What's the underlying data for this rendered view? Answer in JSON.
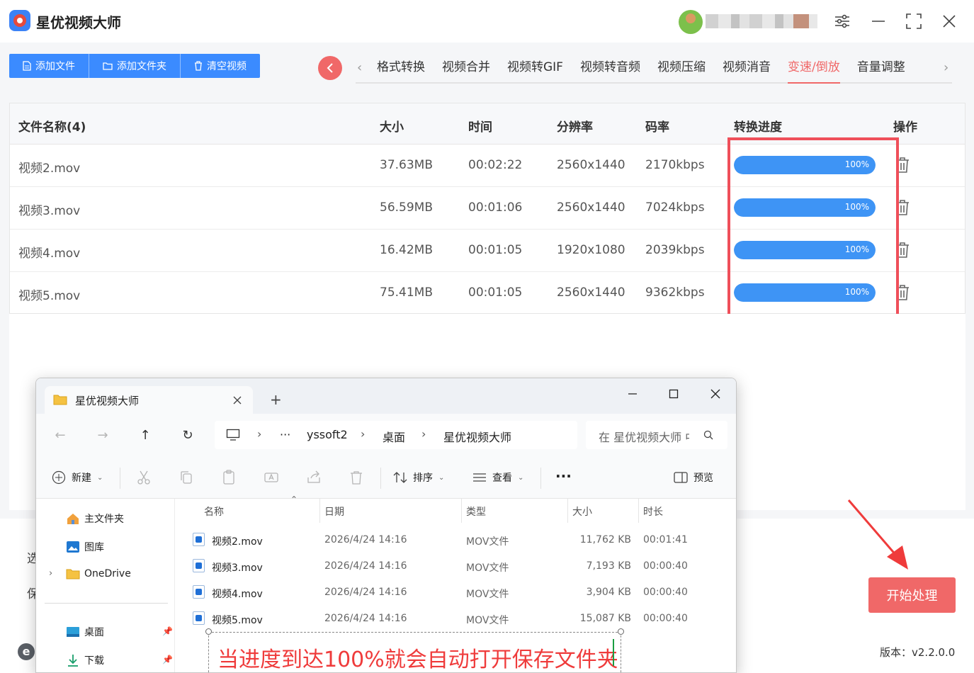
{
  "app": {
    "title": "星优视频大师",
    "version": "版本：v2.2.0.0",
    "accent": "#f06868",
    "primary": "#3b8bff"
  },
  "toolbar": {
    "add_file": "添加文件",
    "add_folder": "添加文件夹",
    "clear": "清空视频"
  },
  "tabs": [
    "格式转换",
    "视频合并",
    "视频转GIF",
    "视频转音频",
    "视频压缩",
    "视频消音",
    "变速/倒放",
    "音量调整"
  ],
  "active_tab": "变速/倒放",
  "table": {
    "headers": {
      "name": "文件名称(4)",
      "size": "大小",
      "time": "时间",
      "resolution": "分辨率",
      "bitrate": "码率",
      "progress": "转换进度",
      "action": "操作"
    },
    "rows": [
      {
        "name": "视频2.mov",
        "size": "37.63MB",
        "time": "00:02:22",
        "resolution": "2560x1440",
        "bitrate": "2170kbps",
        "progress": 100,
        "progress_label": "100%"
      },
      {
        "name": "视频3.mov",
        "size": "56.59MB",
        "time": "00:01:06",
        "resolution": "2560x1440",
        "bitrate": "7024kbps",
        "progress": 100,
        "progress_label": "100%"
      },
      {
        "name": "视频4.mov",
        "size": "16.42MB",
        "time": "00:01:05",
        "resolution": "1920x1080",
        "bitrate": "2039kbps",
        "progress": 100,
        "progress_label": "100%"
      },
      {
        "name": "视频5.mov",
        "size": "75.41MB",
        "time": "00:01:05",
        "resolution": "2560x1440",
        "bitrate": "9362kbps",
        "progress": 100,
        "progress_label": "100%"
      }
    ]
  },
  "bottom": {
    "label1": "选",
    "label2": "保",
    "start_button": "开始处理"
  },
  "explorer": {
    "tab_title": "星优视频大师",
    "breadcrumb": [
      "yssoft2",
      "桌面",
      "星优视频大师"
    ],
    "search_placeholder": "在 星优视频大师 中搜索",
    "commands": {
      "new": "新建",
      "sort": "排序",
      "view": "查看",
      "more": "···",
      "preview": "预览"
    },
    "sidebar": [
      {
        "label": "主文件夹",
        "icon": "home-icon"
      },
      {
        "label": "图库",
        "icon": "gallery-icon"
      },
      {
        "label": "OneDrive",
        "icon": "folder-icon"
      },
      {
        "label": "桌面",
        "icon": "desktop-icon"
      },
      {
        "label": "下载",
        "icon": "download-icon"
      }
    ],
    "columns": {
      "name": "名称",
      "date": "日期",
      "type": "类型",
      "size": "大小",
      "duration": "时长"
    },
    "files": [
      {
        "name": "视频2.mov",
        "date": "2026/4/24 14:16",
        "type": "MOV文件",
        "size": "11,762 KB",
        "duration": "00:01:41"
      },
      {
        "name": "视频3.mov",
        "date": "2026/4/24 14:16",
        "type": "MOV文件",
        "size": "7,193 KB",
        "duration": "00:00:40"
      },
      {
        "name": "视频4.mov",
        "date": "2026/4/24 14:16",
        "type": "MOV文件",
        "size": "3,904 KB",
        "duration": "00:00:40"
      },
      {
        "name": "视频5.mov",
        "date": "2026/4/24 14:16",
        "type": "MOV文件",
        "size": "15,087 KB",
        "duration": "00:00:40"
      }
    ]
  },
  "annotation": {
    "text": "当进度到达100%就会自动打开保存文件夹",
    "color": "#ef3b3b"
  }
}
